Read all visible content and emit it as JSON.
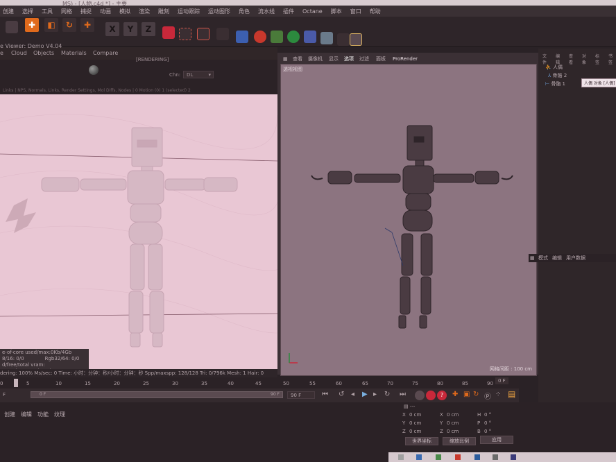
{
  "titlebar": {
    "text": "MS) - [人物.c4d *] - 主要"
  },
  "menu": [
    "创建",
    "选择",
    "工具",
    "网格",
    "捕捉",
    "动画",
    "模拟",
    "渲染",
    "雕刻",
    "运动跟踪",
    "运动图形",
    "角色",
    "流水线",
    "插件",
    "Octane",
    "脚本",
    "窗口",
    "帮助"
  ],
  "toolbar": {
    "x": "X",
    "y": "Y",
    "z": "Z"
  },
  "live_viewer": {
    "title": "e Viewer: Demo V4.04",
    "tabs": [
      "e",
      "Cloud",
      "Objects",
      "Materials",
      "Compare"
    ],
    "rendering_label": "[RENDERING]",
    "chn_label": "Chn:",
    "chn_value": "DL",
    "path": "Links | NPS, Normals, Links, Render Settings, Mol Diffs, Nodes | 0 Motion (0) 1 (selected) 2",
    "stats": [
      "e-of-core used/max:0Kb/4Gb",
      "8/16: 0/0",
      "Rgb32/64: 0/0",
      "d/free/total vram: 783Mb/3.664Gb/6Gb"
    ],
    "status": "dering: 100%   Ms/sec: 0   Time: 小时：分钟：秒/小时：分钟：秒   Spp/maxspp: 128/128   Tri: 0/796k   Mesh: 1   Hair: 0"
  },
  "viewport": {
    "menu": [
      "查看",
      "摄像机",
      "显示",
      "选项",
      "过滤",
      "面板",
      "ProRender"
    ],
    "label": "透视视图",
    "grid_label": "网格间距 : 100 cm"
  },
  "objects": {
    "header": [
      "文件",
      "编辑",
      "查看",
      "对象",
      "标签",
      "书签"
    ],
    "items": [
      "人偶",
      "骨骼 2",
      "骨骼 1"
    ],
    "tooltip": "人偶 对象 [人偶]"
  },
  "attributes": {
    "tabs": [
      "模式",
      "编辑",
      "用户数据"
    ]
  },
  "timeline": {
    "ticks": [
      "5",
      "10",
      "15",
      "20",
      "25",
      "30",
      "35",
      "40",
      "45",
      "50",
      "55",
      "60",
      "65",
      "70",
      "75",
      "80",
      "85",
      "90"
    ],
    "tick0": "0",
    "end_frame": "0 F",
    "current": "0 F",
    "range_end": "90 F",
    "field_90f": "90 F"
  },
  "bottom": {
    "tabs": [
      "创建",
      "编辑",
      "功能",
      "纹理"
    ],
    "coords": {
      "x": "X",
      "y": "Y",
      "z": "Z",
      "x_val": "0 cm",
      "y_val": "0 cm",
      "z_val": "0 cm",
      "x2_val": "0 cm",
      "y2_val": "0 cm",
      "z2_val": "0 cm",
      "h": "H",
      "p": "P",
      "b": "B",
      "h_val": "0 °",
      "p_val": "0 °",
      "b_val": "0 °",
      "mode1": "世界坐标",
      "mode2": "缩放比例",
      "apply": "应用"
    }
  },
  "colors": {
    "accent_orange": "#e06a1c",
    "render_bg": "#e9c7d4",
    "viewport_bg": "#8c7480"
  }
}
